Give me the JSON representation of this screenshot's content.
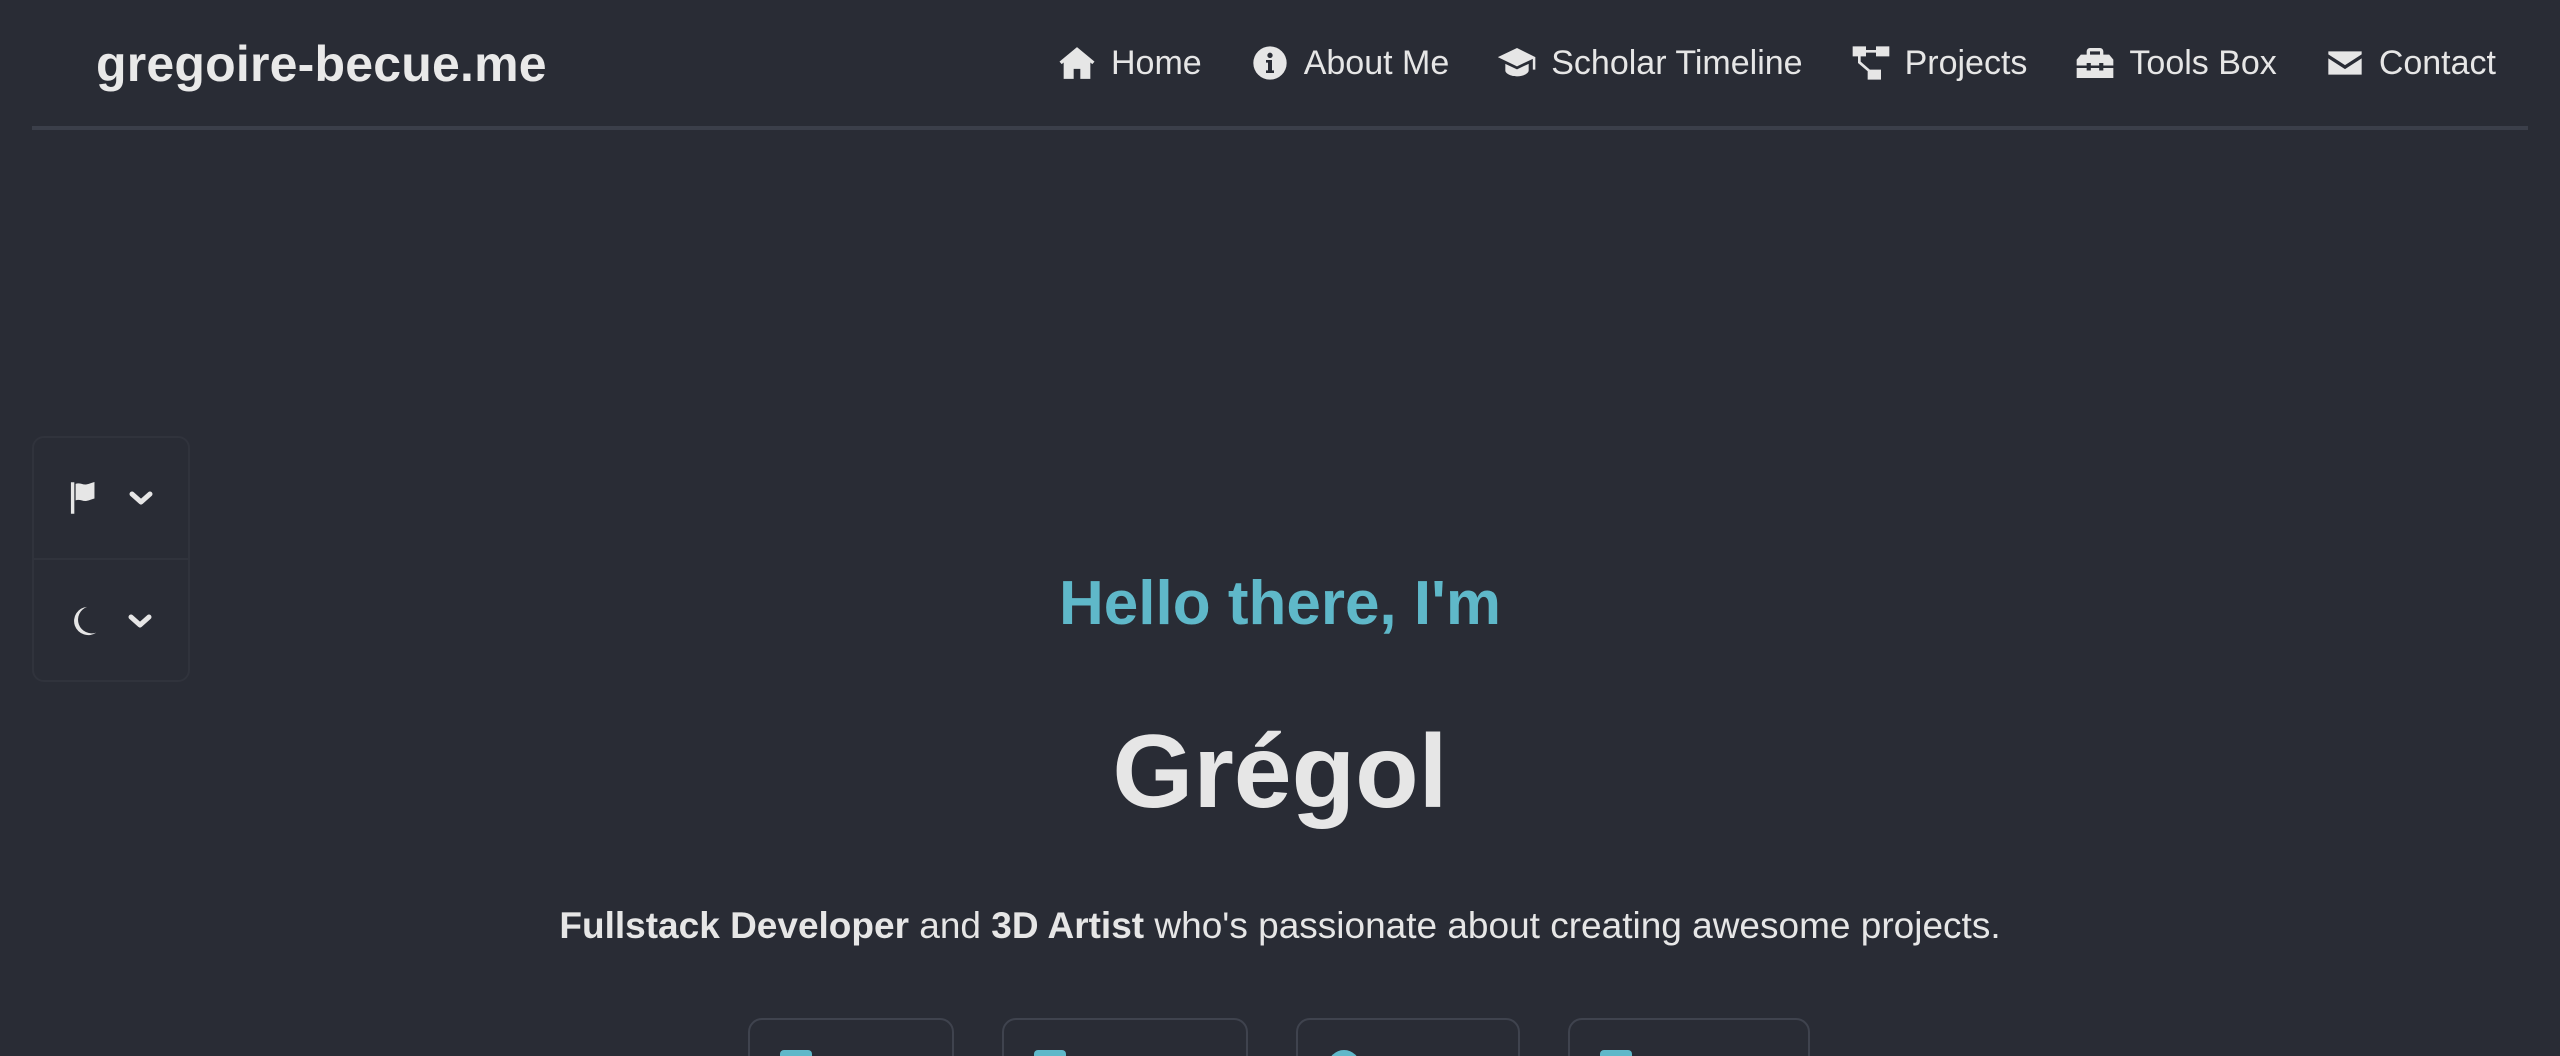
{
  "site": {
    "brand": "gregoire-becue.me"
  },
  "nav": {
    "items": [
      {
        "label": "Home",
        "icon": "home-icon"
      },
      {
        "label": "About Me",
        "icon": "info-icon"
      },
      {
        "label": "Scholar Timeline",
        "icon": "graduation-cap-icon"
      },
      {
        "label": "Projects",
        "icon": "project-diagram-icon"
      },
      {
        "label": "Tools Box",
        "icon": "toolbox-icon"
      },
      {
        "label": "Contact",
        "icon": "envelope-icon"
      }
    ]
  },
  "settings_panel": {
    "language_icon": "flag-icon",
    "theme_icon": "moon-icon",
    "dropdown_icon": "chevron-down-icon"
  },
  "hero": {
    "greeting": "Hello there, I'm",
    "name": "Grégol",
    "tagline": {
      "role1": "Fullstack Developer",
      "connector": "and",
      "role2": "3D Artist",
      "rest": "who's passionate about creating awesome projects."
    }
  },
  "colors": {
    "background": "#292c35",
    "accent": "#5fb8c9",
    "text": "#e6e6e6"
  }
}
